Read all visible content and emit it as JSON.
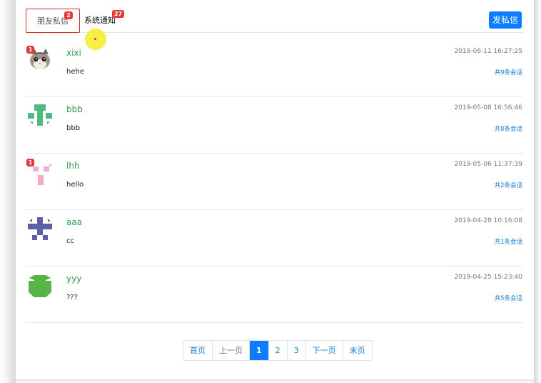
{
  "tabs": {
    "friends": {
      "label": "朋友私信",
      "badge": "2"
    },
    "system": {
      "label": "系统通知",
      "badge": "27"
    }
  },
  "send_button": "发私信",
  "messages": [
    {
      "user": "xixi",
      "text": "hehe",
      "time": "2019-06-11 16:27:25",
      "count": "共9条会话",
      "unread": "1",
      "avatar": "cat-photo"
    },
    {
      "user": "bbb",
      "text": "bbb",
      "time": "2019-05-08 16:56:46",
      "count": "共8条会话",
      "unread": "",
      "avatar": "green-identicon",
      "color": "#4dbb80"
    },
    {
      "user": "lhh",
      "text": "hello",
      "time": "2019-05-06 11:37:39",
      "count": "共2条会话",
      "unread": "1",
      "avatar": "pink-identicon",
      "color": "#f7a8cf"
    },
    {
      "user": "aaa",
      "text": "cc",
      "time": "2019-04-28 10:16:08",
      "count": "共1条会话",
      "unread": "",
      "avatar": "purple-identicon",
      "color": "#5b60a8"
    },
    {
      "user": "yyy",
      "text": "???",
      "time": "2019-04-25 15:23:40",
      "count": "共5条会话",
      "unread": "",
      "avatar": "lime-identicon",
      "color": "#55b546"
    }
  ],
  "pagination": {
    "first": "首页",
    "prev": "上一页",
    "pages": [
      "1",
      "2",
      "3"
    ],
    "current": "1",
    "next": "下一页",
    "last": "末页"
  }
}
